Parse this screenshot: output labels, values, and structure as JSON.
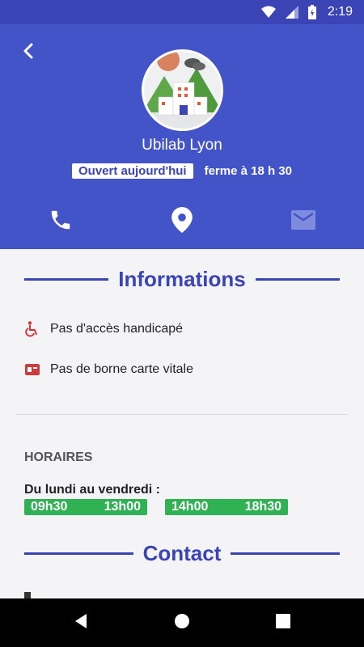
{
  "status_bar": {
    "time": "2:19"
  },
  "header": {
    "place_name": "Ubilab Lyon",
    "open_badge": "Ouvert aujourd'hui",
    "closes_text": "ferme à 18 h 30",
    "colors": {
      "header_bg": "#4353c8",
      "status_bg": "#3a44b4"
    }
  },
  "actions": {
    "icons": [
      "phone-icon",
      "location-pin-icon",
      "email-icon"
    ]
  },
  "informations": {
    "title": "Informations",
    "items": [
      {
        "icon": "wheelchair-icon",
        "label": "Pas d'accès handicapé"
      },
      {
        "icon": "card-reader-icon",
        "label": "Pas de borne carte vitale"
      }
    ]
  },
  "hours": {
    "heading": "HORAIRES",
    "days_label": "Du lundi au vendredi :",
    "slots": [
      {
        "start": "09h30",
        "end": "13h00"
      },
      {
        "start": "14h00",
        "end": "18h30"
      }
    ],
    "slot_color": "#2fb154"
  },
  "contact": {
    "title": "Contact"
  }
}
